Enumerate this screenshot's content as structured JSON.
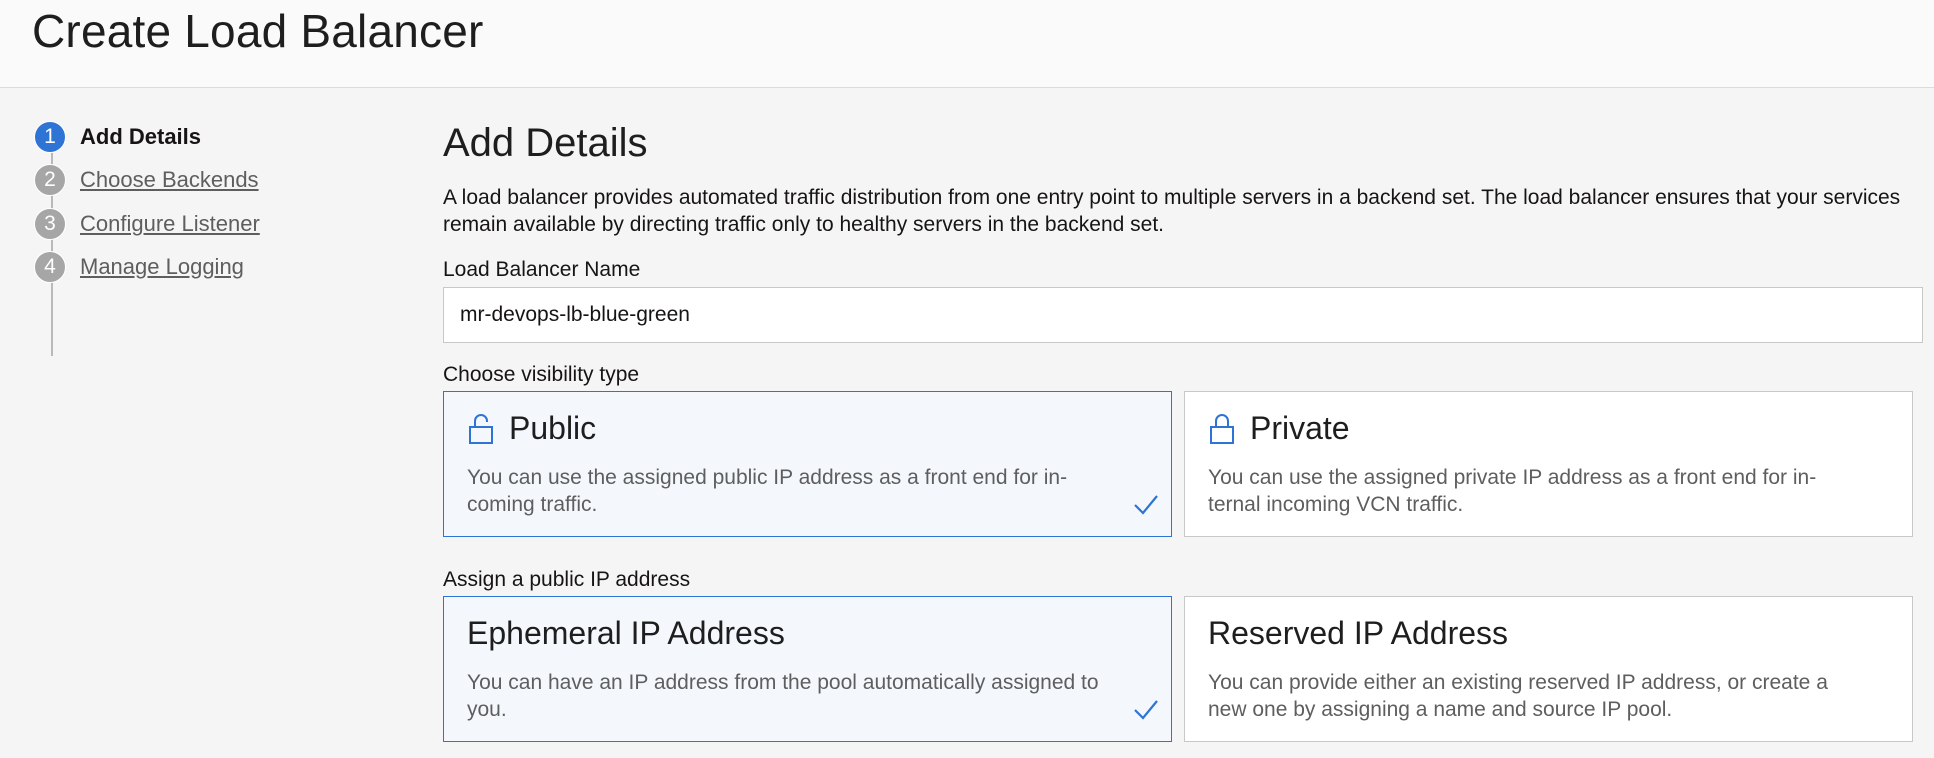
{
  "page_title": "Create Load Balancer",
  "steps": [
    {
      "number": "1",
      "label": "Add Details",
      "active": true
    },
    {
      "number": "2",
      "label": "Choose Backends",
      "active": false
    },
    {
      "number": "3",
      "label": "Configure Listener",
      "active": false
    },
    {
      "number": "4",
      "label": "Manage Logging",
      "active": false
    }
  ],
  "section": {
    "title": "Add Details",
    "description": "A load balancer provides automated traffic distribution from one entry point to multiple servers in a backend set. The load balancer ensures that your services remain available by directing traffic only to healthy servers in the backend set."
  },
  "name_field": {
    "label": "Load Balancer Name",
    "value": "mr-devops-lb-blue-green"
  },
  "visibility": {
    "label": "Choose visibility type",
    "options": [
      {
        "title": "Public",
        "description": "You can use the assigned public IP address as a front end for in-coming traffic.",
        "icon": "unlocked-icon",
        "selected": true
      },
      {
        "title": "Private",
        "description": "You can use the assigned private IP address as a front end for in-ternal incoming VCN traffic.",
        "icon": "locked-icon",
        "selected": false
      }
    ]
  },
  "public_ip": {
    "label": "Assign a public IP address",
    "options": [
      {
        "title": "Ephemeral IP Address",
        "description": "You can have an IP address from the pool automatically assigned to you.",
        "selected": true
      },
      {
        "title": "Reserved IP Address",
        "description": "You can provide either an existing reserved IP address, or create a new one by assigning a name and source IP pool.",
        "selected": false
      }
    ]
  },
  "colors": {
    "accent": "#2d74d4",
    "inactive_step": "#a6a6a6",
    "selected_card_bg": "#f4f8fd"
  }
}
